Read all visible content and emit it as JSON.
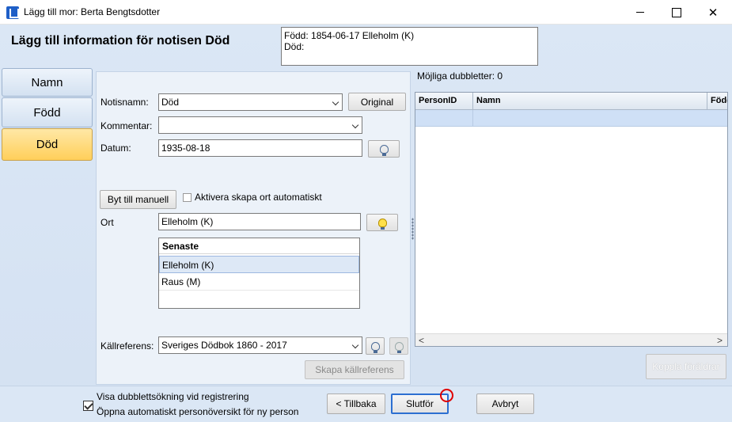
{
  "window": {
    "title": "Lägg till mor: Berta Bengtsdotter",
    "controls": {
      "minimize": "",
      "maximize": "",
      "close": "✕"
    }
  },
  "header": {
    "title": "Lägg till information för notisen Död",
    "info_line1": "Född: 1854-06-17 Elleholm (K)",
    "info_line2": "Död:"
  },
  "nav": {
    "items": [
      {
        "label": "Namn",
        "active": false
      },
      {
        "label": "Född",
        "active": false
      },
      {
        "label": "Död",
        "active": true
      }
    ]
  },
  "form": {
    "notisnamn": {
      "label": "Notisnamn:",
      "value": "Död",
      "button": "Original"
    },
    "kommentar": {
      "label": "Kommentar:",
      "value": ""
    },
    "datum": {
      "label": "Datum:",
      "value": "1935-08-18"
    },
    "switch_button": "Byt till manuell",
    "auto_place": {
      "label": "Aktivera skapa ort automatiskt",
      "checked": false
    },
    "ort": {
      "label": "Ort",
      "value": "Elleholm (K)"
    },
    "recent": {
      "header": "Senaste",
      "items": [
        "Elleholm (K)",
        "Raus (M)"
      ],
      "selected": 0
    },
    "kallreferens": {
      "label": "Källreferens:",
      "value": "Sveriges Dödbok 1860 - 2017"
    },
    "create_source_button": "Skapa källreferens"
  },
  "duplicates": {
    "label": "Möjliga dubbletter: 0",
    "columns": [
      "PersonID",
      "Namn",
      "Född"
    ],
    "link_button": "Koppla föräldrar",
    "scroll_left": "<",
    "scroll_right": ">"
  },
  "bottom": {
    "check_dup": {
      "label": "Visa dubblettsökning vid registrering",
      "checked": true
    },
    "check_overview": {
      "label": "Öppna automatiskt personöversikt för ny person",
      "checked": true
    },
    "back": "< Tillbaka",
    "finish": "Slutför",
    "cancel": "Avbryt"
  },
  "colors": {
    "active_tab": "#ffcf5a",
    "accent": "#1f5fc7",
    "cursor_marker": "#e00000"
  }
}
